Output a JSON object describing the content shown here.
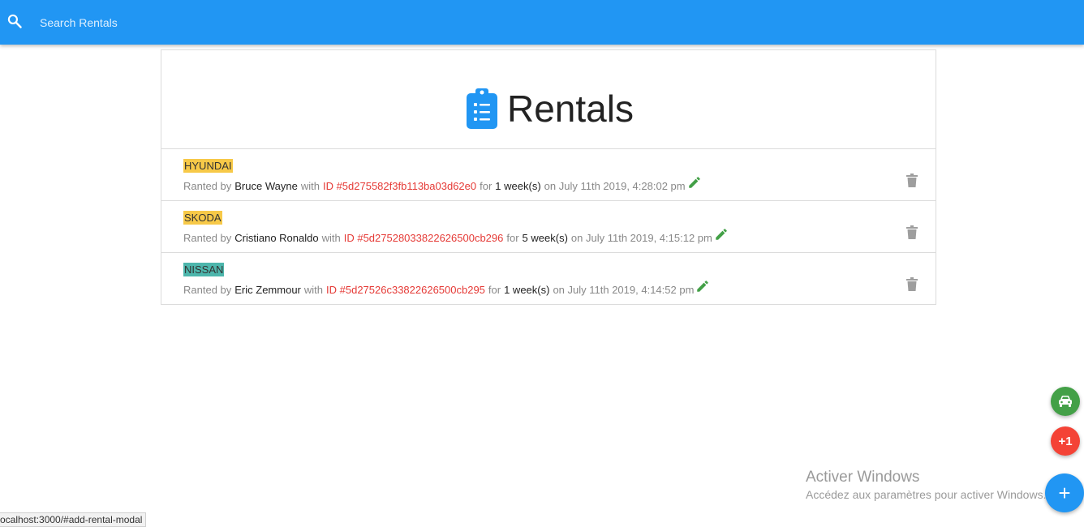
{
  "search": {
    "placeholder": "Search Rentals",
    "value": ""
  },
  "header": {
    "title": "Rentals"
  },
  "rentals": [
    {
      "brand": "HYUNDAI",
      "brand_color": "#f7c948",
      "prefix": "Ranted by",
      "renter": "Bruce Wayne",
      "with": "with",
      "id": "ID #5d275582f3fb113ba03d62e0",
      "for": "for",
      "duration": "1 week(s)",
      "date": "on July 11th 2019, 4:28:02 pm"
    },
    {
      "brand": "SKODA",
      "brand_color": "#f7c948",
      "prefix": "Ranted by",
      "renter": "Cristiano Ronaldo",
      "with": "with",
      "id": "ID #5d27528033822626500cb296",
      "for": "for",
      "duration": "5 week(s)",
      "date": "on July 11th 2019, 4:15:12 pm"
    },
    {
      "brand": "NISSAN",
      "brand_color": "#4db6ac",
      "prefix": "Ranted by",
      "renter": "Eric Zemmour",
      "with": "with",
      "id": "ID #5d27526c33822626500cb295",
      "for": "for",
      "duration": "1 week(s)",
      "date": "on July 11th 2019, 4:14:52 pm"
    }
  ],
  "fabs": {
    "car_icon": "car-icon",
    "plus_one_label": "+1",
    "add_label": "+"
  },
  "watermark": {
    "title": "Activer Windows",
    "subtitle": "Accédez aux paramètres pour activer Windows."
  },
  "statusbar": {
    "url": "ocalhost:3000/#add-rental-modal"
  },
  "colors": {
    "primary": "#2196f3",
    "edit_green": "#43a047",
    "delete_grey": "#9e9e9e",
    "id_red": "#e53935"
  }
}
